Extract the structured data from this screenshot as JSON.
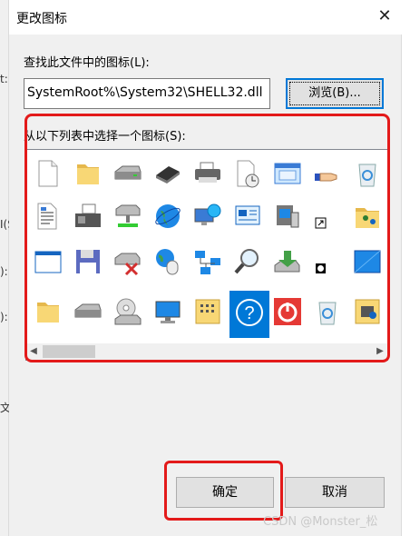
{
  "dialog": {
    "title": "更改图标",
    "close_glyph": "✕"
  },
  "background_fragments": [
    "t:",
    "I(S",
    "):",
    "):",
    "文"
  ],
  "file_label": "查找此文件中的图标(L):",
  "file_path": "SystemRoot%\\System32\\SHELL32.dll",
  "browse_label": "浏览(B)...",
  "list_label": "从以下列表中选择一个图标(S):",
  "icons": [
    [
      "blank-document-icon",
      "folder-icon",
      "drive-icon",
      "memory-chip-icon",
      "printer-icon",
      "document-clock-icon",
      "window-icon",
      "hand-icon",
      "recycle-bin-icon"
    ],
    [
      "text-document-icon",
      "fax-icon",
      "network-drive-icon",
      "globe-icon",
      "network-globe-icon",
      "control-panel-icon",
      "computer-icon",
      "shortcut-icon",
      "shared-folder-icon"
    ],
    [
      "window-blank-icon",
      "floppy-disk-icon",
      "disconnected-drive-icon",
      "mouse-globe-icon",
      "network-icon",
      "search-icon",
      "download-icon",
      "clock-overlay-icon",
      "blue-screen-icon"
    ],
    [
      "folder-icon",
      "drive-icon",
      "cd-drive-icon",
      "monitor-icon",
      "folder-grid-icon",
      "help-icon",
      "power-icon",
      "recycle-bin-icon",
      "toolbox-icon"
    ]
  ],
  "selected_icon": "help-icon",
  "scroll_left": "◀",
  "scroll_right": "▶",
  "ok_label": "确定",
  "cancel_label": "取消",
  "watermark": "CSDN @Monster_松",
  "colors": {
    "accent": "#0078d7",
    "highlight": "#e31a1a"
  }
}
